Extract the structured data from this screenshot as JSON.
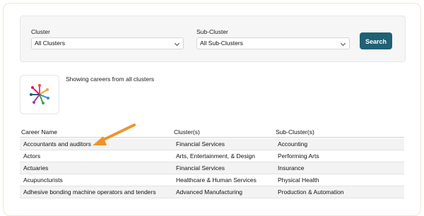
{
  "filters": {
    "cluster_label": "Cluster",
    "cluster_value": "All Clusters",
    "subcluster_label": "Sub-Cluster",
    "subcluster_value": "All Sub-Clusters",
    "search_label": "Search"
  },
  "summary": {
    "showing_text": "Showing careers from all clusters"
  },
  "table": {
    "headers": [
      "Career Name",
      "Cluster(s)",
      "Sub-Cluster(s)"
    ],
    "rows": [
      [
        "Accountants and auditors",
        "Financial Services",
        "Accounting"
      ],
      [
        "Actors",
        "Arts, Entertainment, & Design",
        "Performing Arts"
      ],
      [
        "Actuaries",
        "Financial Services",
        "Insurance"
      ],
      [
        "Acupuncturists",
        "Healthcare & Human Services",
        "Physical Health"
      ],
      [
        "Adhesive bonding machine operators and tenders",
        "Advanced Manufacturing",
        "Production & Automation"
      ]
    ]
  },
  "colors": {
    "accent": "#1f6175",
    "annotation_arrow": "#f0922b"
  },
  "icons": [
    "chevron-down-icon",
    "cluster-logo-icon",
    "annotation-arrow-icon"
  ]
}
